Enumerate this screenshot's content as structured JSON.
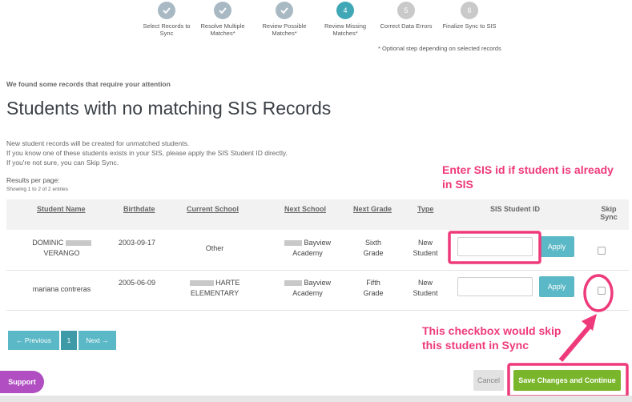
{
  "stepper": {
    "steps": [
      {
        "label": "Select Records to Sync",
        "state": "done",
        "icon": "check-icon"
      },
      {
        "label": "Resolve Multiple Matches*",
        "state": "done",
        "icon": "check-icon"
      },
      {
        "label": "Review Possible Matches*",
        "state": "done",
        "icon": "check-icon"
      },
      {
        "label": "Review Missing Matches*",
        "state": "current",
        "number": "4"
      },
      {
        "label": "Correct Data Errors",
        "state": "pending",
        "number": "5"
      },
      {
        "label": "Finalize Sync to SIS",
        "state": "pending",
        "number": "6"
      }
    ],
    "optional_note": "* Optional step depending on selected records"
  },
  "attention_text": "We found some records that require your attention",
  "page_title": "Students with no matching SIS Records",
  "info_lines": [
    "New student records will be created for unmatched students.",
    "If you know one of these students exists in your SIS, please apply the SIS Student ID directly.",
    "If you're not sure, you can Skip Sync."
  ],
  "results_per_page": "Results per page:",
  "showing": "Showing 1 to 2 of 2 entries",
  "annotations": {
    "sis_id": "Enter SIS id if student is already in SIS",
    "checkbox": "This checkbox would skip this student in Sync"
  },
  "table": {
    "headers": {
      "student_name": "Student Name",
      "birthdate": "Birthdate",
      "current_school": "Current School",
      "next_school": "Next School",
      "next_grade": "Next Grade",
      "type": "Type",
      "sis_student_id": "SIS Student ID",
      "skip_sync": "Skip Sync"
    },
    "rows": [
      {
        "name_first": "DOMINIC",
        "name_last": "VERANGO",
        "birthdate": "2003-09-17",
        "current_school": "Other",
        "next_school_a": "Bayview",
        "next_school_b": "Academy",
        "next_grade_a": "Sixth",
        "next_grade_b": "Grade",
        "type_a": "New",
        "type_b": "Student",
        "sis_id": "",
        "apply": "Apply",
        "skip": false
      },
      {
        "name": "mariana contreras",
        "birthdate": "2005-06-09",
        "current_school_a": "HARTE",
        "current_school_b": "ELEMENTARY",
        "next_school_a": "Bayview",
        "next_school_b": "Academy",
        "next_grade_a": "Fifth",
        "next_grade_b": "Grade",
        "type_a": "New",
        "type_b": "Student",
        "sis_id": "",
        "apply": "Apply",
        "skip": false
      }
    ]
  },
  "pagination": {
    "previous": "← Previous",
    "page": "1",
    "next": "Next →"
  },
  "support": "Support",
  "cancel": "Cancel",
  "save": "Save Changes and Continue",
  "colors": {
    "accent": "#5bb8c6",
    "annotation": "#ee3a7a",
    "save": "#7ab62b",
    "support": "#b04ec2"
  }
}
